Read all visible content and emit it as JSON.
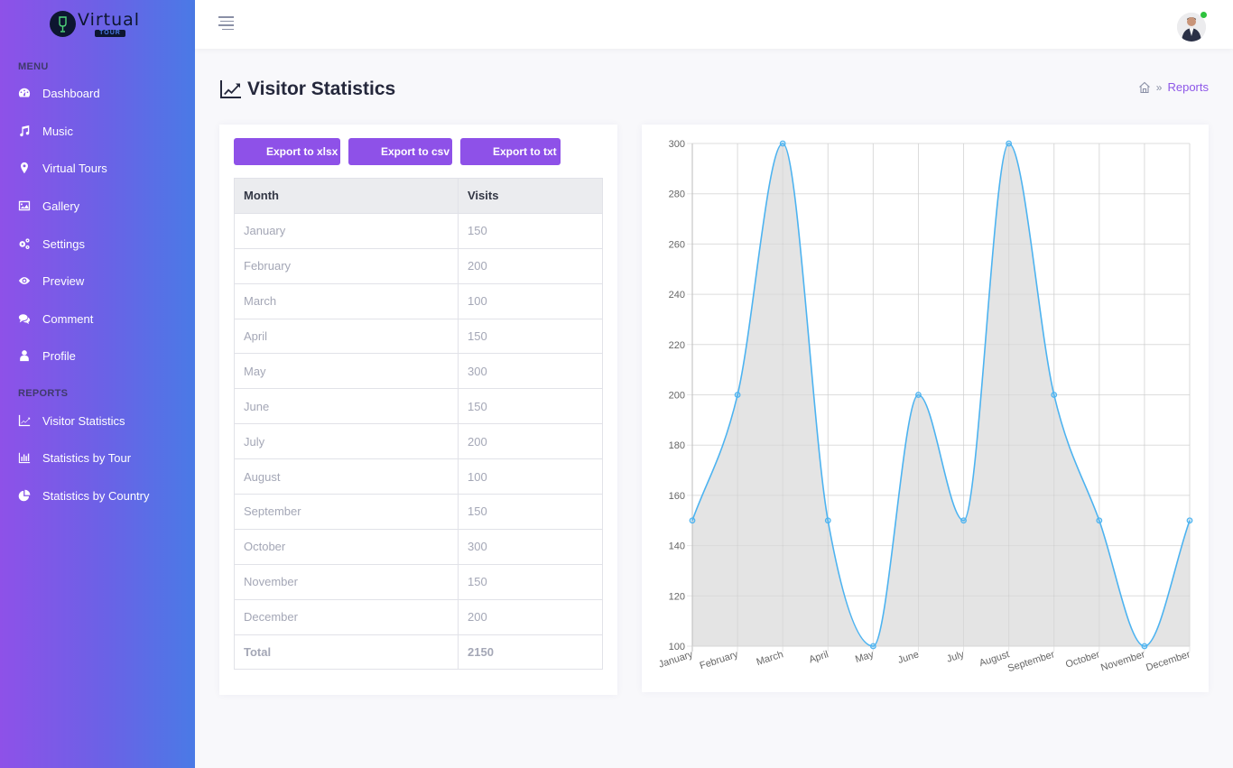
{
  "brand": {
    "name": "Virtual",
    "sub": "TOUR"
  },
  "sidebar": {
    "sections": [
      {
        "heading": "MENU",
        "items": [
          {
            "label": "Dashboard",
            "icon": "dashboard-icon"
          },
          {
            "label": "Music",
            "icon": "music-icon"
          },
          {
            "label": "Virtual Tours",
            "icon": "map-marker-icon"
          },
          {
            "label": "Gallery",
            "icon": "image-icon"
          },
          {
            "label": "Settings",
            "icon": "gears-icon"
          },
          {
            "label": "Preview",
            "icon": "eye-icon"
          },
          {
            "label": "Comment",
            "icon": "comments-icon"
          },
          {
            "label": "Profile",
            "icon": "user-icon"
          }
        ]
      },
      {
        "heading": "REPORTS",
        "items": [
          {
            "label": "Visitor Statistics",
            "icon": "line-chart-icon"
          },
          {
            "label": "Statistics by Tour",
            "icon": "bar-chart-icon"
          },
          {
            "label": "Statistics by Country",
            "icon": "pie-chart-icon"
          }
        ]
      }
    ]
  },
  "header": {
    "user_status": "online"
  },
  "page": {
    "title": "Visitor Statistics",
    "breadcrumb": {
      "home": "home-icon",
      "current": "Reports"
    }
  },
  "toolbar": {
    "export_xlsx": "Export to xlsx",
    "export_csv": "Export to csv",
    "export_txt": "Export to txt"
  },
  "table": {
    "columns": [
      "Month",
      "Visits"
    ],
    "rows": [
      [
        "January",
        "150"
      ],
      [
        "February",
        "200"
      ],
      [
        "March",
        "100"
      ],
      [
        "April",
        "150"
      ],
      [
        "May",
        "300"
      ],
      [
        "June",
        "150"
      ],
      [
        "July",
        "200"
      ],
      [
        "August",
        "100"
      ],
      [
        "September",
        "150"
      ],
      [
        "October",
        "300"
      ],
      [
        "November",
        "150"
      ],
      [
        "December",
        "200"
      ]
    ],
    "total": [
      "Total",
      "2150"
    ]
  },
  "chart_data": {
    "type": "area",
    "title": "",
    "xlabel": "",
    "ylabel": "",
    "categories": [
      "January",
      "February",
      "March",
      "April",
      "May",
      "June",
      "July",
      "August",
      "September",
      "October",
      "November",
      "December"
    ],
    "series": [
      {
        "name": "Visits",
        "values": [
          150,
          200,
          300,
          150,
          100,
          200,
          150,
          300,
          200,
          150,
          100,
          150
        ],
        "color": "#4db3f0",
        "fill": "#e3e3e3"
      }
    ],
    "ylim": [
      100,
      300
    ],
    "yticks": [
      100,
      120,
      140,
      160,
      180,
      200,
      220,
      240,
      260,
      280,
      300
    ],
    "grid": true,
    "legend": "none"
  }
}
